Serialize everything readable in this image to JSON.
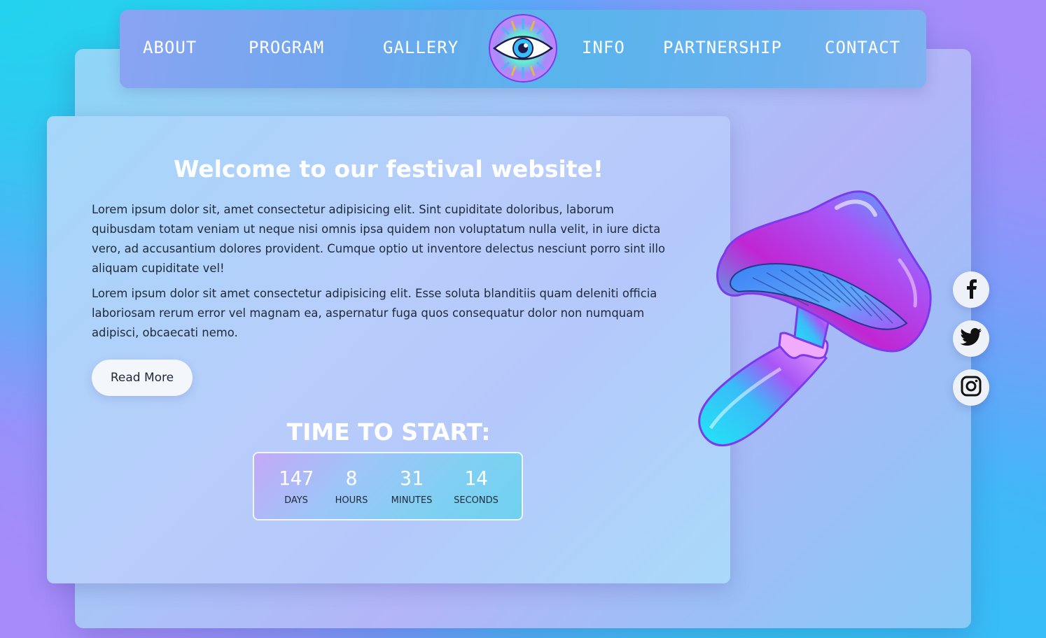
{
  "nav": {
    "left": [
      "ABOUT",
      "PROGRAM",
      "GALLERY"
    ],
    "right": [
      "INFO",
      "PARTNERSHIP",
      "CONTACT"
    ],
    "logo_icon": "eye-logo-icon"
  },
  "main": {
    "heading": "Welcome to our festival website!",
    "paragraph1": "Lorem ipsum dolor sit, amet consectetur adipisicing elit. Sint cupiditate doloribus, laborum quibusdam totam veniam ut neque nisi omnis ipsa quidem non voluptatum nulla velit, in iure dicta vero, ad accusantium dolores provident. Cumque optio ut inventore delectus nesciunt porro sint illo aliquam cupiditate vel!",
    "paragraph2": "Lorem ipsum dolor sit amet consectetur adipisicing elit. Esse soluta blanditiis quam deleniti officia laboriosam rerum error vel magnam ea, aspernatur fuga quos consequatur dolor non numquam adipisci, obcaecati nemo.",
    "read_more_label": "Read More"
  },
  "countdown": {
    "title": "TIME TO START:",
    "units": [
      {
        "value": "147",
        "label": "DAYS"
      },
      {
        "value": "8",
        "label": "HOURS"
      },
      {
        "value": "31",
        "label": "MINUTES"
      },
      {
        "value": "14",
        "label": "SECONDS"
      }
    ]
  },
  "social": {
    "icons": [
      "facebook-icon",
      "twitter-icon",
      "instagram-icon"
    ]
  },
  "colors": {
    "accent_text": "#ffffff",
    "body_text": "#1f2937",
    "mushroom_cyan": "#22e5f5",
    "mushroom_purple": "#a855f7"
  }
}
